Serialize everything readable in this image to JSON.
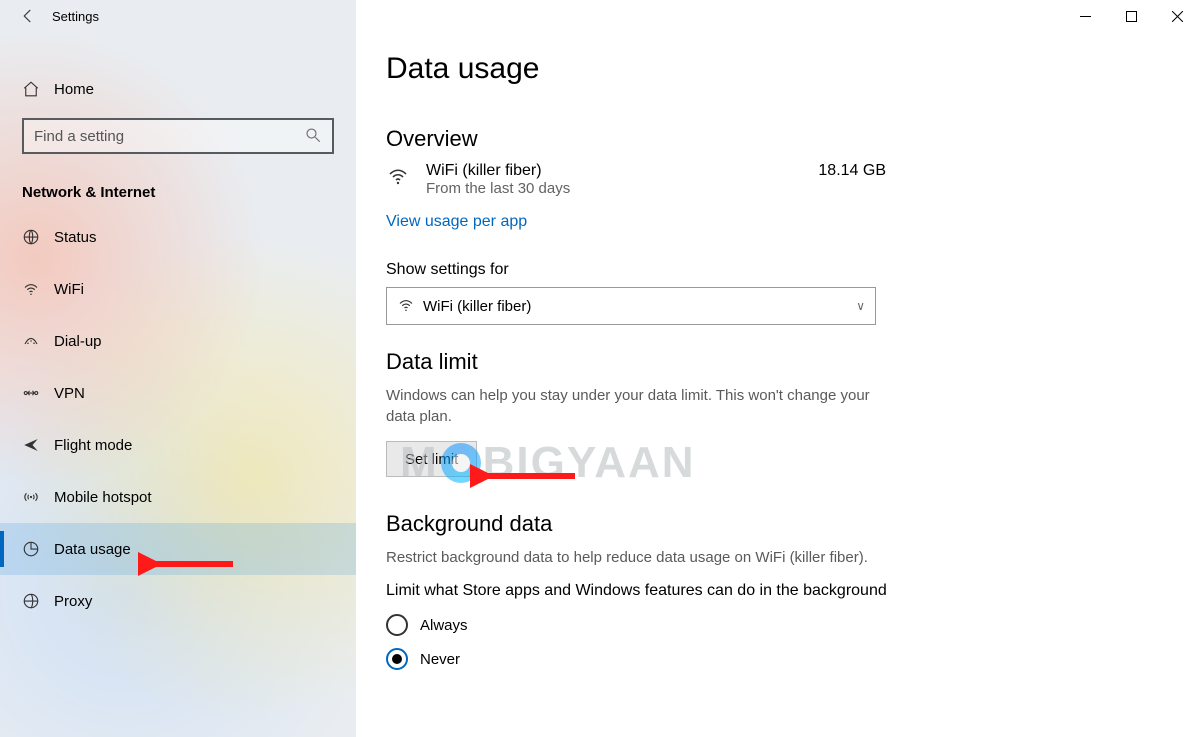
{
  "app_title": "Settings",
  "home_label": "Home",
  "search": {
    "placeholder": "Find a setting"
  },
  "category": "Network & Internet",
  "sidebar": {
    "items": [
      {
        "label": "Status"
      },
      {
        "label": "WiFi"
      },
      {
        "label": "Dial-up"
      },
      {
        "label": "VPN"
      },
      {
        "label": "Flight mode"
      },
      {
        "label": "Mobile hotspot"
      },
      {
        "label": "Data usage"
      },
      {
        "label": "Proxy"
      }
    ],
    "selected_index": 6
  },
  "page": {
    "title": "Data usage",
    "overview": {
      "heading": "Overview",
      "connection_name": "WiFi (killer fiber)",
      "connection_sub": "From the last 30 days",
      "usage_value": "18.14 GB",
      "link": "View usage per app"
    },
    "show_settings": {
      "label": "Show settings for",
      "selected": "WiFi (killer fiber)"
    },
    "data_limit": {
      "heading": "Data limit",
      "desc": "Windows can help you stay under your data limit. This won't change your data plan.",
      "button": "Set limit"
    },
    "background": {
      "heading": "Background data",
      "desc": "Restrict background data to help reduce data usage on WiFi (killer fiber).",
      "sub_label": "Limit what Store apps and Windows features can do in the background",
      "options": {
        "always": "Always",
        "never": "Never"
      },
      "selected": "never"
    }
  },
  "watermark": {
    "pre": "M",
    "post": "BIGYAAN"
  },
  "annotations": {
    "arrow_color": "#ff1a1a",
    "arrow1_target": "sidebar-item-data-usage",
    "arrow2_target": "set-limit-button"
  }
}
